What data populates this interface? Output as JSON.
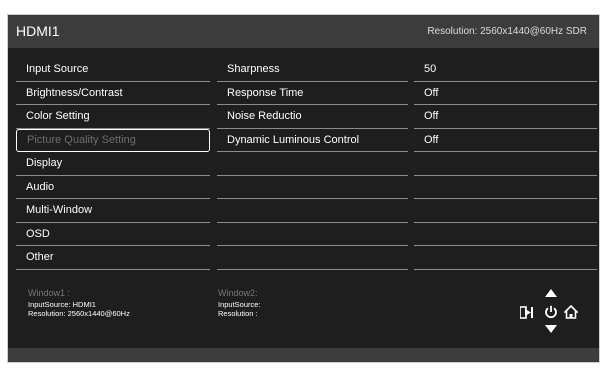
{
  "header": {
    "input_name": "HDMI1",
    "resolution": "Resolution: 2560x1440@60Hz SDR"
  },
  "menu": {
    "items": [
      {
        "label": "Input Source"
      },
      {
        "label": "Brightness/Contrast"
      },
      {
        "label": "Color Setting"
      },
      {
        "label": "Picture Quality Setting"
      },
      {
        "label": "Display"
      },
      {
        "label": "Audio"
      },
      {
        "label": "Multi-Window"
      },
      {
        "label": "OSD"
      },
      {
        "label": "Other"
      }
    ]
  },
  "submenu": {
    "items": [
      {
        "label": "Sharpness",
        "value": "50"
      },
      {
        "label": "Response Time",
        "value": "Off"
      },
      {
        "label": "Noise Reductio",
        "value": "Off"
      },
      {
        "label": "Dynamic Luminous Control",
        "value": "Off"
      }
    ]
  },
  "footer": {
    "window1": {
      "label": "Window1 :",
      "input": "InputSource: HDMI1",
      "resolution": "Resolution: 2560x1440@60Hz"
    },
    "window2": {
      "label": "Window2:",
      "input": "InputSource:",
      "resolution": "Resolution :"
    }
  },
  "icons": [
    "up-arrow-icon",
    "down-arrow-icon",
    "exit-icon",
    "power-icon",
    "home-icon"
  ]
}
